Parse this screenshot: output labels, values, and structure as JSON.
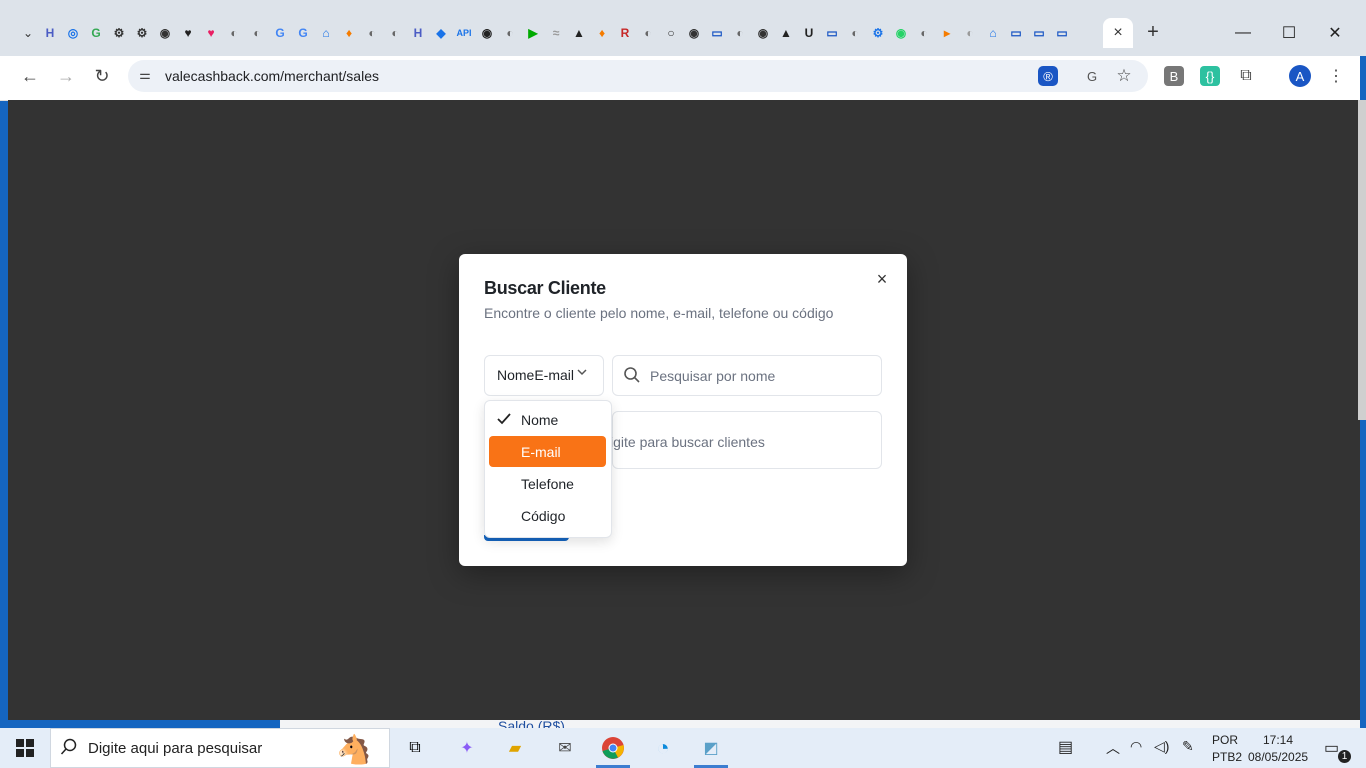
{
  "browser": {
    "url": "valecashback.com/merchant/sales",
    "active_tab_close": "×",
    "new_tab": "+",
    "profile_initial": "A",
    "tab_favicons": [
      "H",
      "◎",
      "G",
      "⚙",
      "⚙",
      "◉",
      "♥",
      "♥",
      "◐",
      "◐",
      "G",
      "G",
      "⌂",
      "♦",
      "◐",
      "◐",
      "H",
      "◆",
      "API",
      "◉",
      "◐",
      "▶",
      "≈",
      "▲",
      "♦",
      "R",
      "◐",
      "○",
      "◉",
      "▭",
      "◐",
      "◉",
      "▲",
      "U",
      "▭",
      "◐",
      "⚙",
      "◉",
      "◐",
      "▸",
      "◐",
      "⌂",
      "▭",
      "▭",
      "▭"
    ]
  },
  "modal": {
    "title": "Buscar Cliente",
    "subtitle": "Encontre o cliente pelo nome, e-mail, telefone ou código",
    "select_display": "NomeE-mail",
    "search_placeholder": "Pesquisar por nome",
    "results_hint": "igite para buscar clientes",
    "close_icon": "×"
  },
  "dropdown": {
    "options": [
      {
        "label": "Nome",
        "checked": true,
        "highlighted": false
      },
      {
        "label": "E-mail",
        "checked": false,
        "highlighted": true
      },
      {
        "label": "Telefone",
        "checked": false,
        "highlighted": false
      },
      {
        "label": "Código",
        "checked": false,
        "highlighted": false
      }
    ],
    "highlight_color": "#f97316"
  },
  "page": {
    "background_label": "Saldo (R$)"
  },
  "taskbar": {
    "search_placeholder": "Digite aqui para pesquisar",
    "lang_top": "POR",
    "lang_bottom": "PTB2",
    "time": "17:14",
    "date": "08/05/2025",
    "notification_count": "1"
  },
  "colors": {
    "overlay": "#333333",
    "primary": "#1565c0",
    "accent": "#f97316"
  }
}
